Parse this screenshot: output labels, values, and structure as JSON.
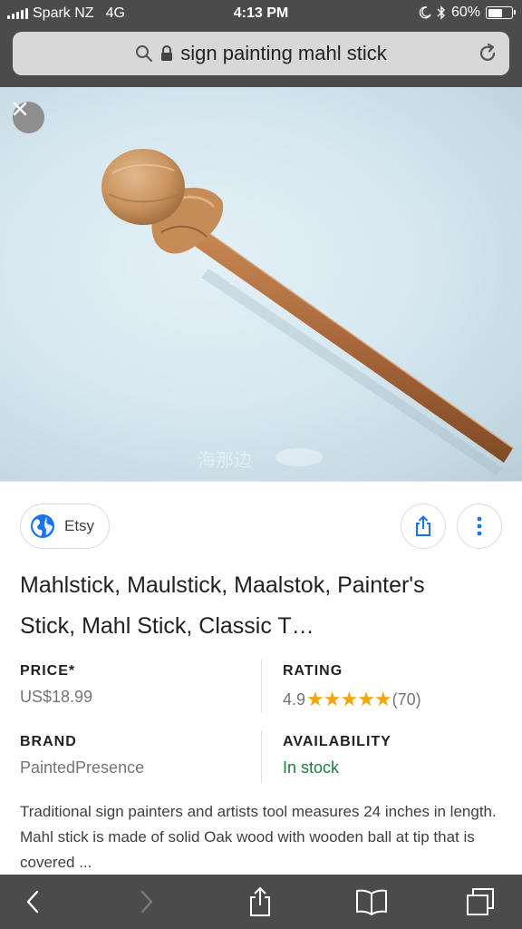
{
  "status_bar": {
    "carrier": "Spark NZ",
    "network": "4G",
    "time": "4:13 PM",
    "battery": "60%",
    "battery_level": 0.6
  },
  "address_bar": {
    "query": "sign painting mahl stick"
  },
  "result": {
    "source": "Etsy",
    "title": "Mahlstick, Maulstick, Maalstok, Painter's Stick, Mahl Stick, Classic T…",
    "price_label": "PRICE*",
    "price_value": "US$18.99",
    "rating_label": "RATING",
    "rating_value": "4.9",
    "rating_stars": "★★★★★",
    "rating_count": "(70)",
    "brand_label": "BRAND",
    "brand_value": "PaintedPresence",
    "availability_label": "AVAILABILITY",
    "availability_value": "In stock",
    "description": "Traditional sign painters and artists tool measures 24 inches in length. Mahl stick is made of solid Oak wood with wooden ball at tip that is covered ..."
  },
  "colors": {
    "chrome": "#4b4b4b",
    "address_field": "#d8d8d8",
    "in_stock": "#188038",
    "star": "#f2a60c",
    "globe": "#1a73e8"
  },
  "icons": [
    "signal-icon",
    "moon-icon",
    "bluetooth-icon",
    "battery-icon",
    "search-icon",
    "lock-icon",
    "reload-icon",
    "close-icon",
    "globe-icon",
    "share-icon",
    "more-vert-icon",
    "back-icon",
    "forward-icon",
    "bookmarks-icon",
    "tabs-icon"
  ]
}
